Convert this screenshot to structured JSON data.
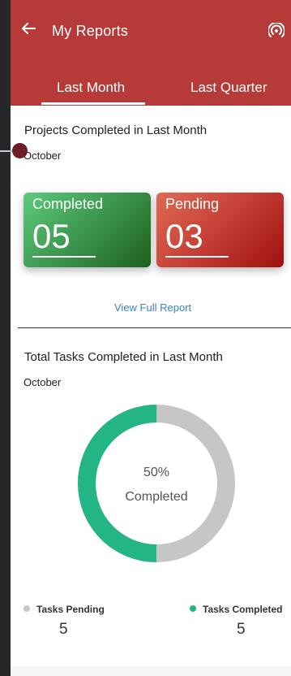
{
  "app": {
    "title": "My Reports",
    "header_color": "#b63a37"
  },
  "tabs": [
    {
      "label": "Last Month",
      "selected": true
    },
    {
      "label": "Last Quarter",
      "selected": false
    }
  ],
  "projects": {
    "title": "Projects Completed in Last Month",
    "subtitle": "October",
    "completed": {
      "label": "Completed",
      "value": "05"
    },
    "pending": {
      "label": "Pending",
      "value": "03"
    },
    "link": "View Full Report"
  },
  "tasks": {
    "title": "Total Tasks Completed in Last Month",
    "subtitle": "October",
    "percent_text": "50%",
    "center_label": "Completed",
    "donut_fraction_completed": 0.5,
    "colors": {
      "completed": "#24b587",
      "pending": "#c6c6c6"
    },
    "legend": [
      {
        "label": "Tasks Pending",
        "value": "5",
        "color": "#c6c6c6"
      },
      {
        "label": "Tasks Completed",
        "value": "5",
        "color": "#24b587"
      }
    ]
  },
  "icons": [
    "back-arrow-icon",
    "broadcast-icon"
  ]
}
